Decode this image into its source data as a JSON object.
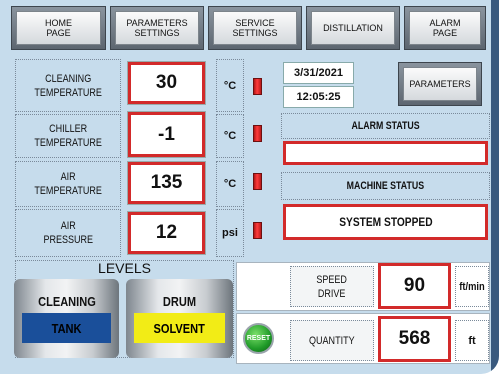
{
  "nav": [
    {
      "label": "HOME\nPAGE"
    },
    {
      "label": "PARAMETERS\nSETTINGS"
    },
    {
      "label": "SERVICE\nSETTINGS"
    },
    {
      "label": "DISTILLATION"
    },
    {
      "label": "ALARM\nPAGE"
    }
  ],
  "measurements": [
    {
      "label": "CLEANING\nTEMPERATURE",
      "value": "30",
      "unit": "°C"
    },
    {
      "label": "CHILLER\nTEMPERATURE",
      "value": "-1",
      "unit": "°C"
    },
    {
      "label": "AIR\nTEMPERATURE",
      "value": "135",
      "unit": "°C"
    },
    {
      "label": "AIR\nPRESSURE",
      "value": "12",
      "unit": "psi"
    }
  ],
  "datetime": {
    "date": "3/31/2021",
    "time": "12:05:25"
  },
  "parameters_button": "PARAMETERS",
  "alarm": {
    "label": "ALARM STATUS",
    "value": ""
  },
  "machine": {
    "label": "MACHINE STATUS",
    "value": "SYSTEM STOPPED"
  },
  "levels": {
    "title": "LEVELS",
    "tanks": [
      {
        "top": "CLEANING",
        "bottom": "TANK",
        "color": "#1a4f9a",
        "text_color": "#111111"
      },
      {
        "top": "DRUM",
        "bottom": "SOLVENT",
        "color": "#f2ec16",
        "text_color": "#111111"
      }
    ]
  },
  "speed": {
    "label": "SPEED\nDRIVE",
    "value": "90",
    "unit": "ft/min"
  },
  "quantity": {
    "reset_label": "RESET",
    "label": "QUANTITY",
    "value": "568",
    "unit": "ft"
  },
  "colors": {
    "alarm_red": "#d22a2a",
    "tank_blue": "#1a4f9a",
    "tank_yellow": "#f2ec16",
    "reset_green": "#1f9a28"
  }
}
